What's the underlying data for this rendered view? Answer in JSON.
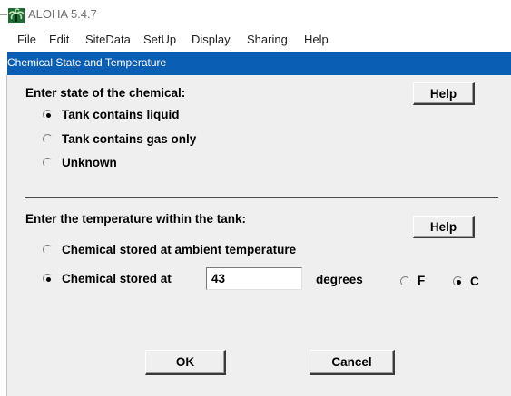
{
  "app": {
    "title": "ALOHA 5.4.7"
  },
  "menu": [
    "File",
    "Edit",
    "SiteData",
    "SetUp",
    "Display",
    "Sharing",
    "Help"
  ],
  "dialog": {
    "title": "Chemical State and Temperature",
    "state_section": {
      "prompt": "Enter state of the chemical:",
      "help_label": "Help",
      "options": [
        {
          "label": "Tank contains liquid",
          "selected": true
        },
        {
          "label": "Tank contains gas only",
          "selected": false
        },
        {
          "label": "Unknown",
          "selected": false
        }
      ]
    },
    "temperature_section": {
      "prompt": "Enter the temperature within the tank:",
      "help_label": "Help",
      "ambient_option": {
        "label": "Chemical stored at ambient temperature",
        "selected": false
      },
      "stored_option": {
        "label": "Chemical stored at",
        "selected": true
      },
      "temperature_value": "43",
      "units_label": "degrees",
      "unit_f": {
        "label": "F",
        "selected": false
      },
      "unit_c": {
        "label": "C",
        "selected": true
      }
    },
    "ok_label": "OK",
    "cancel_label": "Cancel"
  },
  "colors": {
    "dialog_title_bg": "#0a5fb4",
    "dialog_bg": "#efefef"
  }
}
